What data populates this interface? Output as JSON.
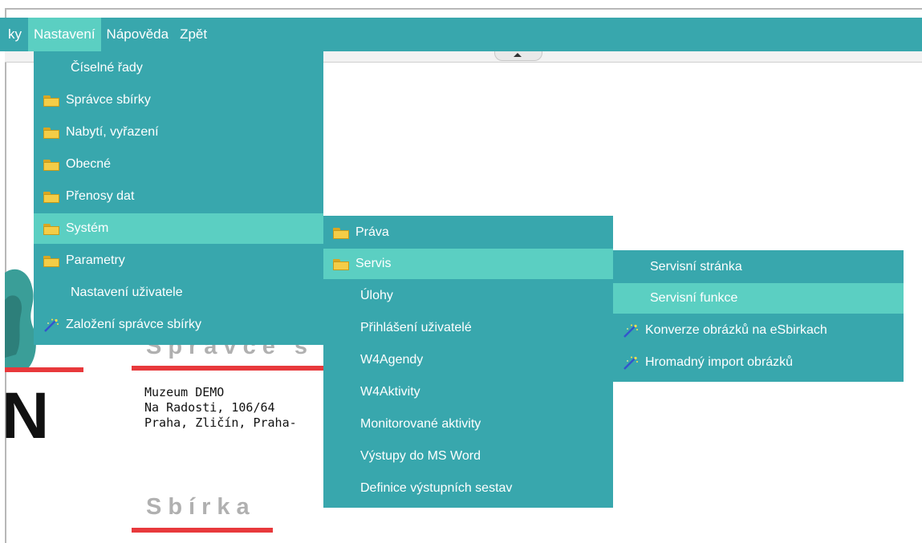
{
  "menubar": {
    "items": [
      {
        "label": "ky",
        "active": false
      },
      {
        "label": "Nastavení",
        "active": true
      },
      {
        "label": "Nápověda",
        "active": false
      },
      {
        "label": "Zpět",
        "active": false
      }
    ]
  },
  "menu_nastaveni": {
    "items": [
      {
        "label": "Číselné řady",
        "icon": "none"
      },
      {
        "label": "Správce sbírky",
        "icon": "folder-icon"
      },
      {
        "label": "Nabytí, vyřazení",
        "icon": "folder-icon"
      },
      {
        "label": "Obecné",
        "icon": "folder-icon"
      },
      {
        "label": "Přenosy dat",
        "icon": "folder-icon"
      },
      {
        "label": "Systém",
        "icon": "folder-icon",
        "active": true
      },
      {
        "label": "Parametry",
        "icon": "folder-icon"
      },
      {
        "label": "Nastavení uživatele",
        "icon": "none"
      },
      {
        "label": "Založení správce sbírky",
        "icon": "wizard-wand-icon"
      }
    ]
  },
  "menu_system": {
    "items": [
      {
        "label": "Práva",
        "icon": "folder-icon"
      },
      {
        "label": "Servis",
        "icon": "folder-icon",
        "active": true
      },
      {
        "label": "Úlohy",
        "icon": "none"
      },
      {
        "label": "Přihlášení uživatelé",
        "icon": "none"
      },
      {
        "label": "W4Agendy",
        "icon": "none"
      },
      {
        "label": "W4Aktivity",
        "icon": "none"
      },
      {
        "label": "Monitorované aktivity",
        "icon": "none"
      },
      {
        "label": "Výstupy do MS Word",
        "icon": "none"
      },
      {
        "label": "Definice výstupních sestav",
        "icon": "none"
      }
    ]
  },
  "menu_servis": {
    "items": [
      {
        "label": "Servisní stránka",
        "icon": "none"
      },
      {
        "label": "Servisní funkce",
        "icon": "none",
        "active": true
      },
      {
        "label": "Konverze obrázků na eSbirkach",
        "icon": "wizard-wand-icon"
      },
      {
        "label": "Hromadný import obrázků",
        "icon": "wizard-wand-icon"
      }
    ]
  },
  "page": {
    "section_spravce": "Správce s",
    "address": [
      "Muzeum DEMO",
      "Na Radosti, 106/64",
      "Praha, Zličín, Praha-"
    ],
    "section_sbirka": "Sbírka",
    "logo_letter": "N"
  },
  "colors": {
    "menu_bg": "#38a7ad",
    "menu_active": "#5bcfc2",
    "accent_red": "#e8393c",
    "heading_gray": "#b0b0b0"
  }
}
